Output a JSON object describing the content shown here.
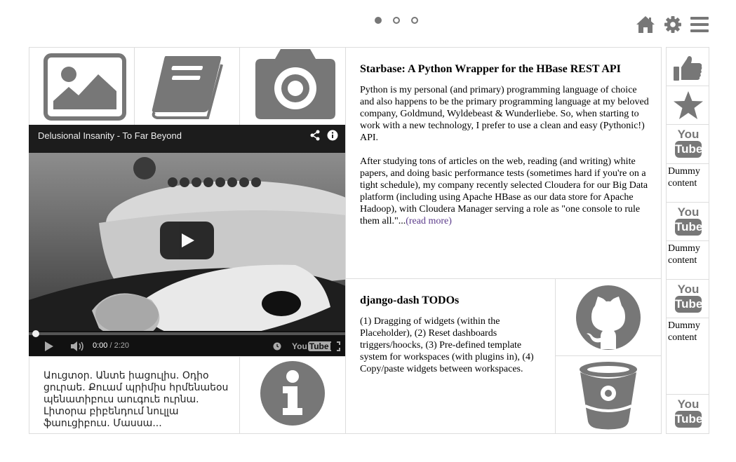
{
  "carousel": {
    "dots": 3,
    "active": 0
  },
  "top_icons": [
    "home-icon",
    "gear-icon",
    "menu-icon"
  ],
  "video": {
    "title": "Delusional Insanity - To Far Beyond",
    "time_current": "0:00",
    "time_separator": " / ",
    "time_total": "2:20",
    "yt_label": "You",
    "yt_tube": "Tube"
  },
  "armenian_text": "Աուցտօր. Անտե իացուլիս. Օդիօ ցուրաե. Քուամ պրիմիս հրմենաեօս պենատիբուս աուգուե ուրնա. Լիտօրա բիբենդում նուլլա ֆաուցիբուս. Մասսա...",
  "article": {
    "title": "Starbase: A Python Wrapper for the HBase REST API",
    "para1": "Python is my personal (and primary) programming language of choice and also happens to be the primary programming language at my beloved company, Goldmund, Wyldebeast & Wunderliebe. So, when starting to work with a new technology, I prefer to use a clean and easy (Pythonic!) API.",
    "para2": "After studying tons of articles on the web, reading (and writing) white papers, and doing basic performance tests (sometimes hard if you're on a tight schedule), my company recently selected Cloudera for our Big Data platform (including using Apache HBase as our data store for Apache Hadoop), with Cloudera Manager serving a role as \"one console to rule them all.\"...",
    "read_more": "(read more)"
  },
  "todos": {
    "title": "django-dash TODOs",
    "body": "(1) Dragging of widgets (within the Placeholder), (2) Reset dashboards triggers/hoocks, (3) Pre-defined template system for workspaces (with plugins in), (4) Copy/paste widgets between workspaces."
  },
  "sidebar": {
    "yt_you": "You",
    "yt_tube": "Tube",
    "dummy": [
      "Dummy content",
      "Dummy content",
      "Dummy content"
    ]
  },
  "colors": {
    "icon": "#777777",
    "border": "#dddddd",
    "link": "#5a3a8a"
  }
}
